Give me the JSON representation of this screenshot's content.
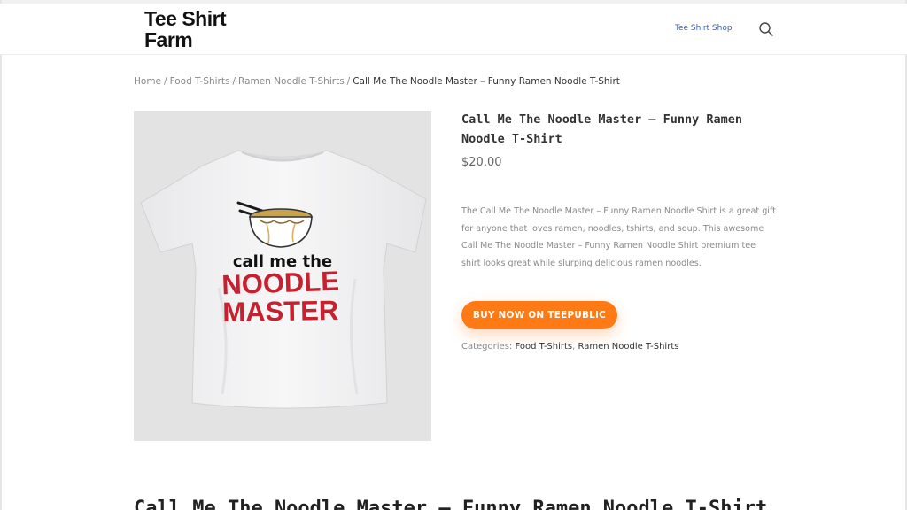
{
  "header": {
    "logo_line1": "Tee Shirt",
    "logo_line2": "Farm",
    "nav_link": "Tee Shirt Shop"
  },
  "breadcrumb": {
    "items": [
      "Home",
      "Food T-Shirts",
      "Ramen Noodle T-Shirts"
    ],
    "separator": "/",
    "current": "Call Me The Noodle Master – Funny Ramen Noodle T-Shirt"
  },
  "product": {
    "title": "Call Me The Noodle Master – Funny Ramen Noodle T-Shirt",
    "price": "$20.00",
    "description": "The Call Me The Noodle Master – Funny Ramen Noodle Shirt is a great gift for anyone that loves ramen, noodles, tshirts, and soup. This awesome Call Me The Noodle Master – Funny Ramen Noodle Shirt premium tee shirt looks great while slurping delicious ramen noodles.",
    "buy_button": "BUY NOW ON TEEPUBLIC",
    "categories_label": "Categories:",
    "categories": [
      "Food T-Shirts",
      "Ramen Noodle T-Shirts"
    ],
    "shirt_text_line1": "call me the",
    "shirt_text_line2": "NOODLE",
    "shirt_text_line3": "MASTER"
  },
  "section_heading": "Call Me The Noodle Master – Funny Ramen Noodle T-Shirt",
  "colors": {
    "accent": "#ff7a14",
    "nav_link": "#3a5da8",
    "shirt_red": "#c8202f"
  },
  "icons": {
    "search": "search-icon"
  }
}
